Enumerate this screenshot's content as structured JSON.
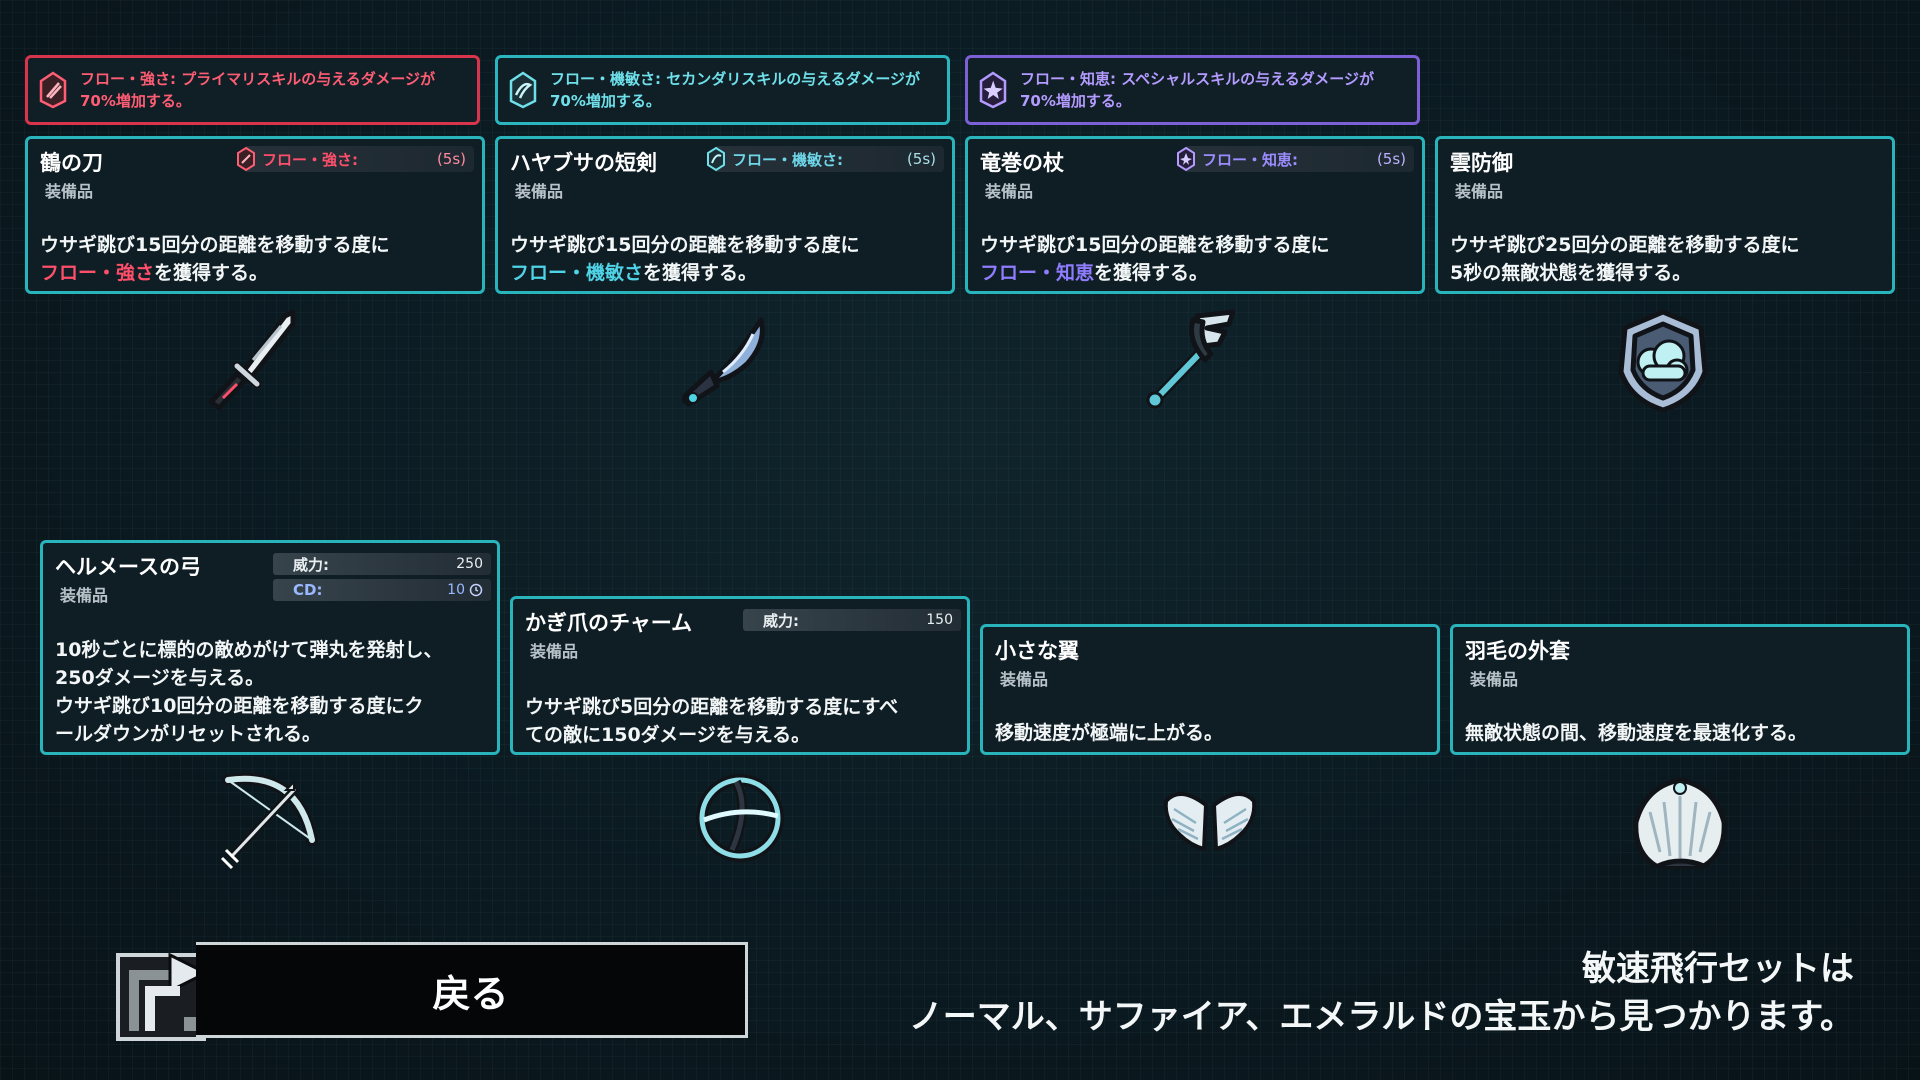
{
  "bonuses": [
    {
      "text": "フロー・強さ: プライマリスキルの与えるダメージが70%増加する。",
      "line1": "フロー・強さ: プライマリスキルの与えるダメージが",
      "line2": "70%増加する。",
      "color": "#d8344b"
    },
    {
      "text": "フロー・機敏さ: セカンダリスキルの与えるダメージが70%増加する。",
      "line1": "フロー・機敏さ: セカンダリスキルの与えるダメージが",
      "line2": "70%増加する。",
      "color": "#2bb6bf"
    },
    {
      "text": "フロー・知恵: スペシャルスキルの与えるダメージが70%増加する。",
      "line1": "フロー・知恵: スペシャルスキルの与えるダメージが",
      "line2": "70%増加する。",
      "color": "#7d5fd6"
    }
  ],
  "items": [
    {
      "name": "鶴の刀",
      "type": "装備品",
      "tag": "フロー・強さ:",
      "tag_value": "(5s)",
      "desc1_pre": "ウサギ跳び15回分の距離を移動する度に",
      "desc2_hl": "フロー・強さ",
      "desc2_post": "を獲得する。",
      "icon": "katana-icon"
    },
    {
      "name": "ハヤブサの短剣",
      "type": "装備品",
      "tag": "フロー・機敏さ:",
      "tag_value": "(5s)",
      "desc1_pre": "ウサギ跳び15回分の距離を移動する度に",
      "desc2_hl": "フロー・機敏さ",
      "desc2_post": "を獲得する。",
      "icon": "dagger-icon"
    },
    {
      "name": "竜巻の杖",
      "type": "装備品",
      "tag": "フロー・知恵:",
      "tag_value": "(5s)",
      "desc1_pre": "ウサギ跳び15回分の距離を移動する度に",
      "desc2_hl": "フロー・知恵",
      "desc2_post": "を獲得する。",
      "icon": "tornado-staff-icon"
    },
    {
      "name": "雲防御",
      "type": "装備品",
      "desc1": "ウサギ跳び25回分の距離を移動する度に",
      "desc2": "5秒の無敵状態を獲得する。",
      "icon": "cloud-shield-icon"
    },
    {
      "name": "ヘルメースの弓",
      "type": "装備品",
      "power_label": "威力:",
      "power": "250",
      "cd_label": "CD:",
      "cd": "10",
      "desc": [
        "10秒ごとに標的の敵めがけて弾丸を発射し、",
        "250ダメージを与える。",
        "ウサギ跳び10回分の距離を移動する度にク",
        "ールダウンがリセットされる。"
      ],
      "icon": "bow-icon"
    },
    {
      "name": "かぎ爪のチャーム",
      "type": "装備品",
      "power_label": "威力:",
      "power": "150",
      "desc": [
        "ウサギ跳び5回分の距離を移動する度にすべ",
        "ての敵に150ダメージを与える。"
      ],
      "icon": "claw-charm-icon"
    },
    {
      "name": "小さな翼",
      "type": "装備品",
      "desc": [
        "移動速度が極端に上がる。"
      ],
      "icon": "small-wings-icon"
    },
    {
      "name": "羽毛の外套",
      "type": "装備品",
      "desc": [
        "無敵状態の間、移動速度を最速化する。"
      ],
      "icon": "feather-cloak-icon"
    }
  ],
  "back_button": {
    "label": "戻る"
  },
  "footer": {
    "line1": "敏速飛行セットは",
    "line2": "ノーマル、サファイア、エメラルドの宝玉から見つかります。"
  }
}
